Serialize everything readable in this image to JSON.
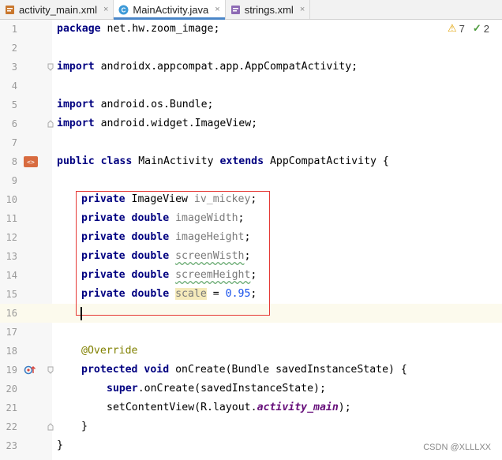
{
  "tabs": [
    {
      "label": "activity_main.xml",
      "icon": "xml-layout-icon",
      "active": false
    },
    {
      "label": "MainActivity.java",
      "icon": "java-class-icon",
      "active": true
    },
    {
      "label": "strings.xml",
      "icon": "xml-values-icon",
      "active": false
    }
  ],
  "tab_close_glyph": "×",
  "inspections": {
    "warnings": "7",
    "weak_warnings": "2",
    "warning_glyph": "⚠",
    "check_glyph": "✓"
  },
  "line_numbers": [
    "1",
    "2",
    "3",
    "4",
    "5",
    "6",
    "7",
    "8",
    "9",
    "10",
    "11",
    "12",
    "13",
    "14",
    "15",
    "16",
    "17",
    "18",
    "19",
    "20",
    "21",
    "22",
    "23"
  ],
  "code": {
    "l1_kw": "package",
    "l1_rest": " net.hw.zoom_image;",
    "l3_kw": "import",
    "l3_rest": " androidx.appcompat.app.AppCompatActivity;",
    "l5_kw": "import",
    "l5_rest": " android.os.Bundle;",
    "l6_kw": "import",
    "l6_rest": " android.widget.ImageView;",
    "l8_kw1": "public",
    "l8_kw2": "class",
    "l8_name": " MainActivity ",
    "l8_kw3": "extends",
    "l8_rest": " AppCompatActivity {",
    "l10_kw": "private",
    "l10_type": " ImageView ",
    "l10_field": "iv_mickey",
    "l10_end": ";",
    "l11_kw": "private double",
    "l11_field": "imageWidth",
    "l11_end": ";",
    "l12_kw": "private double",
    "l12_field": "imageHeight",
    "l12_end": ";",
    "l13_kw": "private double",
    "l13_field": "screenWisth",
    "l13_end": ";",
    "l14_kw": "private double",
    "l14_field": "screemHeight",
    "l14_end": ";",
    "l15_kw": "private double",
    "l15_field": "scale",
    "l15_eq": " = ",
    "l15_num": "0.95",
    "l15_end": ";",
    "l18_ann": "@Override",
    "l19_kw": "protected void",
    "l19_rest": " onCreate(Bundle savedInstanceState) {",
    "l20_kw": "super",
    "l20_rest": ".onCreate(savedInstanceState);",
    "l21_pre": "setContentView(R.layout.",
    "l21_static": "activity_main",
    "l21_end": ");",
    "l22": "}",
    "l23": "}"
  },
  "watermark": "CSDN @XLLLXX",
  "colors": {
    "keyword": "#000080",
    "field": "#7a7a7a",
    "number": "#1750eb",
    "annotation": "#808000",
    "highlight_box": "#e53935",
    "current_line": "#fcfaed"
  }
}
